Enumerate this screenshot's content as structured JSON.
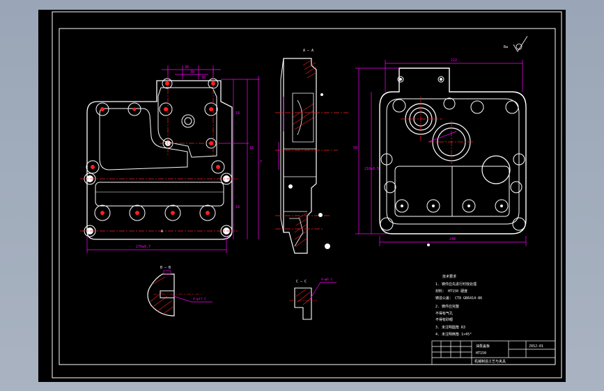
{
  "colors": {
    "background": "#a4afbd",
    "sheet": "#000000",
    "outline": "#ffffff",
    "dimension": "#ff00ff",
    "centerline": "#ff2020",
    "hatch": "#ff2020"
  },
  "views": {
    "left_view": {
      "dims_top": [
        "30",
        "30",
        "30"
      ],
      "dims_right": [
        "18",
        "18",
        "7",
        "18"
      ],
      "dim_bottom": "270±0.7"
    },
    "section": {
      "label": "A — A"
    },
    "right_view": {
      "dim_top": "222",
      "dims_left": [
        "50",
        "210±0.5"
      ],
      "dim_bottom": "248"
    },
    "roughness": "Ra"
  },
  "details": {
    "detail_left": {
      "label": "B — B",
      "callout": "4—φ17 C"
    },
    "detail_mid": {
      "label": "C — C",
      "callout": "4—φ6 C"
    }
  },
  "notes": [
    "技术要求",
    "1. 铸件应先进行时效处理",
    "   材料： HT150 硬度",
    "   铸造公差： CT8 GB6414-86",
    "2. 铸件应完整",
    "   不得有气孔",
    "   不得有砂眼",
    "3. 未注明圆角 R3",
    "4. 未注明倒角 1×45°"
  ],
  "title_block": {
    "part_name": "油泵盖板",
    "material": "HT150",
    "school": "机械制造工艺与夹具",
    "drawing_no": "JXSJ-01"
  }
}
